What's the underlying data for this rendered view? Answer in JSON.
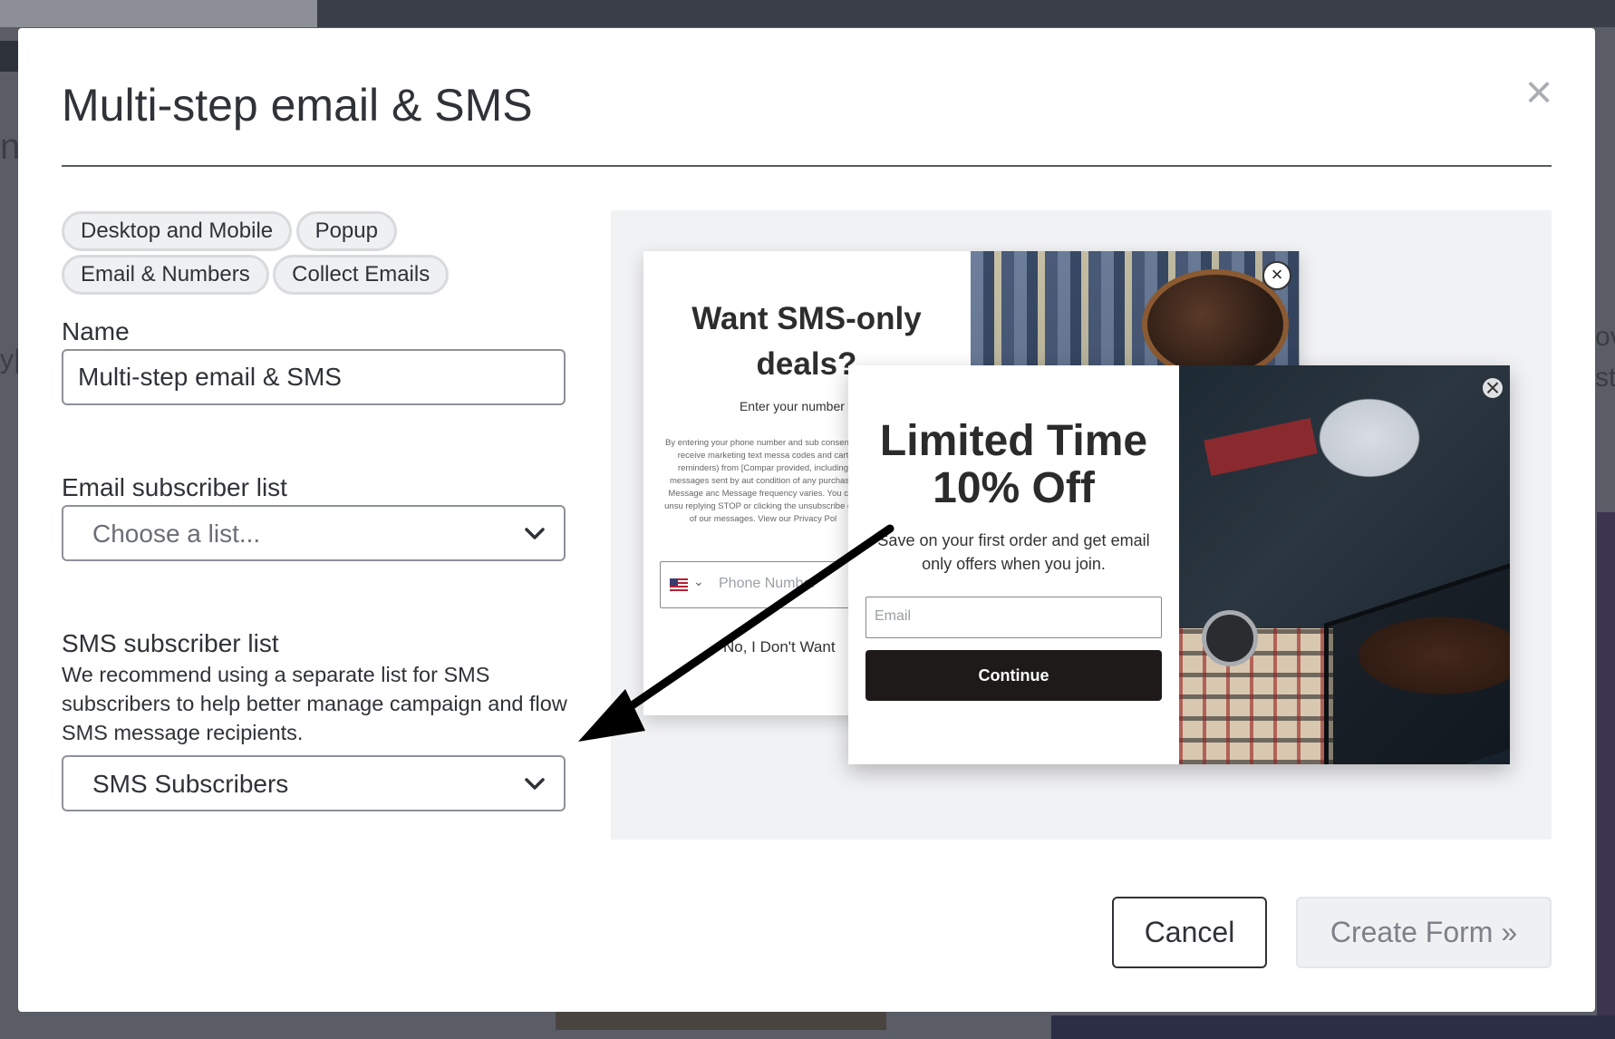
{
  "background": {
    "edge_text_left_1": "n",
    "edge_text_left_2": "y|",
    "edge_text_right_1": "ov",
    "edge_text_right_2": "st"
  },
  "modal": {
    "title": "Multi-step email & SMS",
    "close_icon": "close-icon",
    "tags": [
      "Desktop and Mobile",
      "Popup",
      "Email & Numbers",
      "Collect Emails"
    ],
    "name": {
      "label": "Name",
      "value": "Multi-step email & SMS"
    },
    "email_list": {
      "label": "Email subscriber list",
      "placeholder": "Choose a list..."
    },
    "sms_list": {
      "label": "SMS subscriber list",
      "help": "We recommend using a separate list for SMS subscribers to help better manage campaign and flow SMS message recipients.",
      "value": "SMS Subscribers"
    },
    "buttons": {
      "cancel": "Cancel",
      "create": "Create Form »"
    }
  },
  "preview": {
    "sms_popup": {
      "heading": "Want SMS-only deals?",
      "subtext": "Enter your number to get S",
      "fine_print": "By entering your phone number and sub consent to receive marketing text messa codes and cart reminders) from [Compar provided, including messages sent by aut condition of any purchase. Message anc Message frequency varies. You can unsu replying STOP or clicking the unsubscribe one of our messages. View our Privacy Pol",
      "phone_placeholder": "Phone Number",
      "decline": "No, I Don't Want"
    },
    "email_popup": {
      "heading_line1": "Limited Time",
      "heading_line2": "10% Off",
      "subtext": "Save on your first order and get email only offers when you join.",
      "email_placeholder": "Email",
      "button": "Continue"
    }
  },
  "colors": {
    "overlay": "#5a5d66",
    "text": "#2f3237",
    "button_dark": "#1e1a1a",
    "tag_bg": "#eef0f2",
    "preview_bg": "#f1f2f4"
  }
}
